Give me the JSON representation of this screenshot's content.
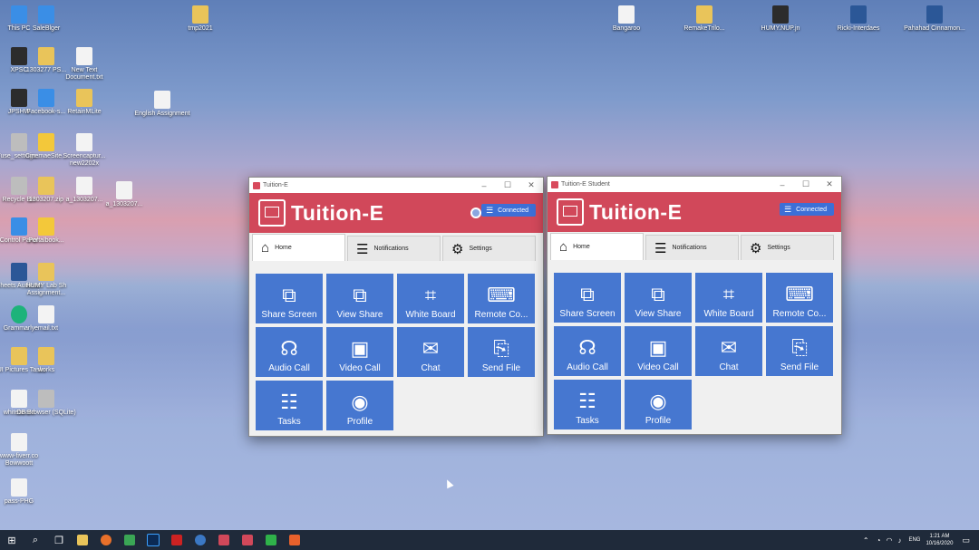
{
  "desktop": {
    "icons": [
      {
        "label": "This PC",
        "kind": "pc"
      },
      {
        "label": "SaleBlger",
        "kind": "pc"
      },
      {
        "label": "tmp2021",
        "kind": "folder"
      },
      {
        "label": "Bangaroo",
        "kind": "doc"
      },
      {
        "label": "RemakeTrilo...",
        "kind": "folder"
      },
      {
        "label": "HUMY.NUP.jn",
        "kind": "app"
      },
      {
        "label": "Ricki-Interdaes",
        "kind": "word"
      },
      {
        "label": "Pahahad Cinnamon...",
        "kind": "word"
      },
      {
        "label": "XPSC",
        "kind": "app"
      },
      {
        "label": "1303277 PS...",
        "kind": "folder"
      },
      {
        "label": "New Text Document.txt",
        "kind": "doc"
      },
      {
        "label": "JPSHW",
        "kind": "app"
      },
      {
        "label": "Facebook-s...",
        "kind": "pc"
      },
      {
        "label": "RetainMLite",
        "kind": "folder"
      },
      {
        "label": "English Assignment",
        "kind": "doc"
      },
      {
        "label": "Tuse_settings...",
        "kind": "gray"
      },
      {
        "label": "CinemaeSite...",
        "kind": "py"
      },
      {
        "label": "Screencaptur... new2202x",
        "kind": "doc"
      },
      {
        "label": "Recycle Bin",
        "kind": "gray"
      },
      {
        "label": "1303207.zip",
        "kind": "folder"
      },
      {
        "label": "a_1303207...",
        "kind": "doc"
      },
      {
        "label": "a_1303207...",
        "kind": "doc"
      },
      {
        "label": "Control Panel",
        "kind": "pc"
      },
      {
        "label": "Portalbook...",
        "kind": "py"
      },
      {
        "label": "Sheets Audioset",
        "kind": "word"
      },
      {
        "label": "HUMY Lab Sh Assignment...",
        "kind": "folder"
      },
      {
        "label": "Grammarly",
        "kind": "green"
      },
      {
        "label": "email.txt",
        "kind": "doc"
      },
      {
        "label": "GUI Pictures Tasks",
        "kind": "folder"
      },
      {
        "label": "works",
        "kind": "folder"
      },
      {
        "label": "whiteboard",
        "kind": "doc"
      },
      {
        "label": "DB Browser (SQLite)",
        "kind": "gray"
      },
      {
        "label": "www-fiverr.co Bowwoott",
        "kind": "doc"
      },
      {
        "label": "pass-PHG",
        "kind": "doc"
      }
    ]
  },
  "windows": [
    {
      "title": "Tuition-E",
      "app_title": "Tuition-E",
      "status": "Connected",
      "tabs": [
        {
          "label": "Home",
          "icon": "home-icon",
          "glyph": "⌂"
        },
        {
          "label": "Notifications",
          "icon": "notifications-icon",
          "glyph": "☰"
        },
        {
          "label": "Settings",
          "icon": "gear-icon",
          "glyph": "⚙"
        }
      ],
      "tiles": [
        {
          "label": "Share Screen",
          "icon": "share-screen-icon",
          "glyph": "⧉"
        },
        {
          "label": "View Share",
          "icon": "view-share-icon",
          "glyph": "⧉"
        },
        {
          "label": "White Board",
          "icon": "whiteboard-icon",
          "glyph": "⌗"
        },
        {
          "label": "Remote Co...",
          "icon": "remote-control-icon",
          "glyph": "⌨"
        },
        {
          "label": "Audio Call",
          "icon": "headset-icon",
          "glyph": "☊"
        },
        {
          "label": "Video Call",
          "icon": "video-call-icon",
          "glyph": "▣"
        },
        {
          "label": "Chat",
          "icon": "chat-icon",
          "glyph": "✉"
        },
        {
          "label": "Send File",
          "icon": "send-file-icon",
          "glyph": "⎘"
        },
        {
          "label": "Tasks",
          "icon": "tasks-icon",
          "glyph": "☷"
        },
        {
          "label": "Profile",
          "icon": "profile-icon",
          "glyph": "◉"
        }
      ]
    },
    {
      "title": "Tuition-E Student",
      "app_title": "Tuition-E",
      "status": "Connected",
      "tabs": [
        {
          "label": "Home",
          "icon": "home-icon",
          "glyph": "⌂"
        },
        {
          "label": "Notifications",
          "icon": "notifications-icon",
          "glyph": "☰"
        },
        {
          "label": "Settings",
          "icon": "gear-icon",
          "glyph": "⚙"
        }
      ],
      "tiles": [
        {
          "label": "Share Screen",
          "icon": "share-screen-icon",
          "glyph": "⧉"
        },
        {
          "label": "View Share",
          "icon": "view-share-icon",
          "glyph": "⧉"
        },
        {
          "label": "White Board",
          "icon": "whiteboard-icon",
          "glyph": "⌗"
        },
        {
          "label": "Remote Co...",
          "icon": "remote-control-icon",
          "glyph": "⌨"
        },
        {
          "label": "Audio Call",
          "icon": "headset-icon",
          "glyph": "☊"
        },
        {
          "label": "Video Call",
          "icon": "video-call-icon",
          "glyph": "▣"
        },
        {
          "label": "Chat",
          "icon": "chat-icon",
          "glyph": "✉"
        },
        {
          "label": "Send File",
          "icon": "send-file-icon",
          "glyph": "⎘"
        },
        {
          "label": "Tasks",
          "icon": "tasks-icon",
          "glyph": "☷"
        },
        {
          "label": "Profile",
          "icon": "profile-icon",
          "glyph": "◉"
        }
      ]
    }
  ],
  "taskbar": {
    "language": "ENG",
    "time": "1:21 AM",
    "date": "10/16/2020"
  },
  "colors": {
    "banner": "#d1485a",
    "tile": "#4677d0",
    "connected": "#3d6fd6"
  }
}
